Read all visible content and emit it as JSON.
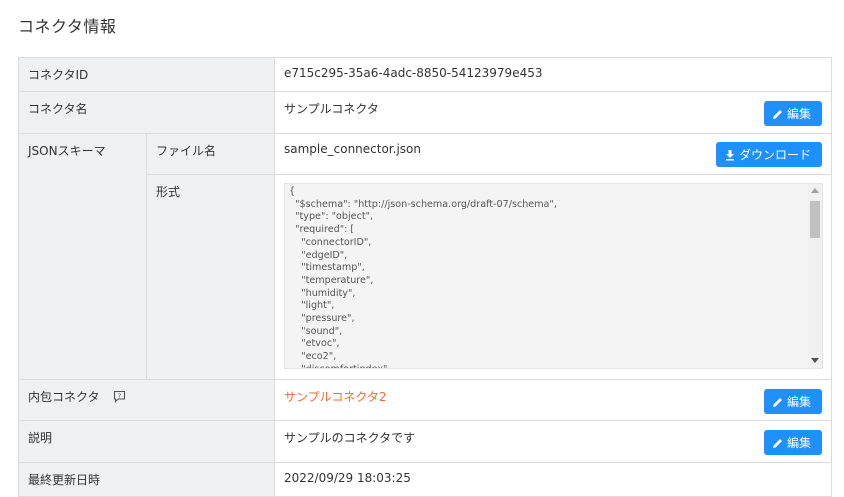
{
  "page": {
    "title": "コネクタ情報"
  },
  "labels": {
    "connector_id": "コネクタID",
    "connector_name": "コネクタ名",
    "json_schema": "JSONスキーマ",
    "file_name": "ファイル名",
    "format": "形式",
    "included_connector": "内包コネクタ",
    "description": "説明",
    "last_updated": "最終更新日時"
  },
  "values": {
    "connector_id": "e715c295-35a6-4adc-8850-54123979e453",
    "connector_name": "サンプルコネクタ",
    "file_name": "sample_connector.json",
    "included_connector": "サンプルコネクタ2",
    "description": "サンプルのコネクタです",
    "last_updated": "2022/09/29 18:03:25"
  },
  "schema_lines": [
    "{",
    "  \"$schema\": \"http://json-schema.org/draft-07/schema\",",
    "  \"type\": \"object\",",
    "  \"required\": [",
    "    \"connectorID\",",
    "    \"edgeID\",",
    "    \"timestamp\",",
    "    \"temperature\",",
    "    \"humidity\",",
    "    \"light\",",
    "    \"pressure\",",
    "    \"sound\",",
    "    \"etvoc\",",
    "    \"eco2\",",
    "    \"discomfortindex\","
  ],
  "buttons": {
    "edit": "編集",
    "download": "ダウンロード"
  },
  "icons": {
    "edit": "pencil-icon",
    "download": "download-icon",
    "help": "help-comment-icon"
  },
  "colors": {
    "primary_button": "#1e90ff",
    "link": "#f06a35",
    "label_bg": "#eef0f2"
  }
}
